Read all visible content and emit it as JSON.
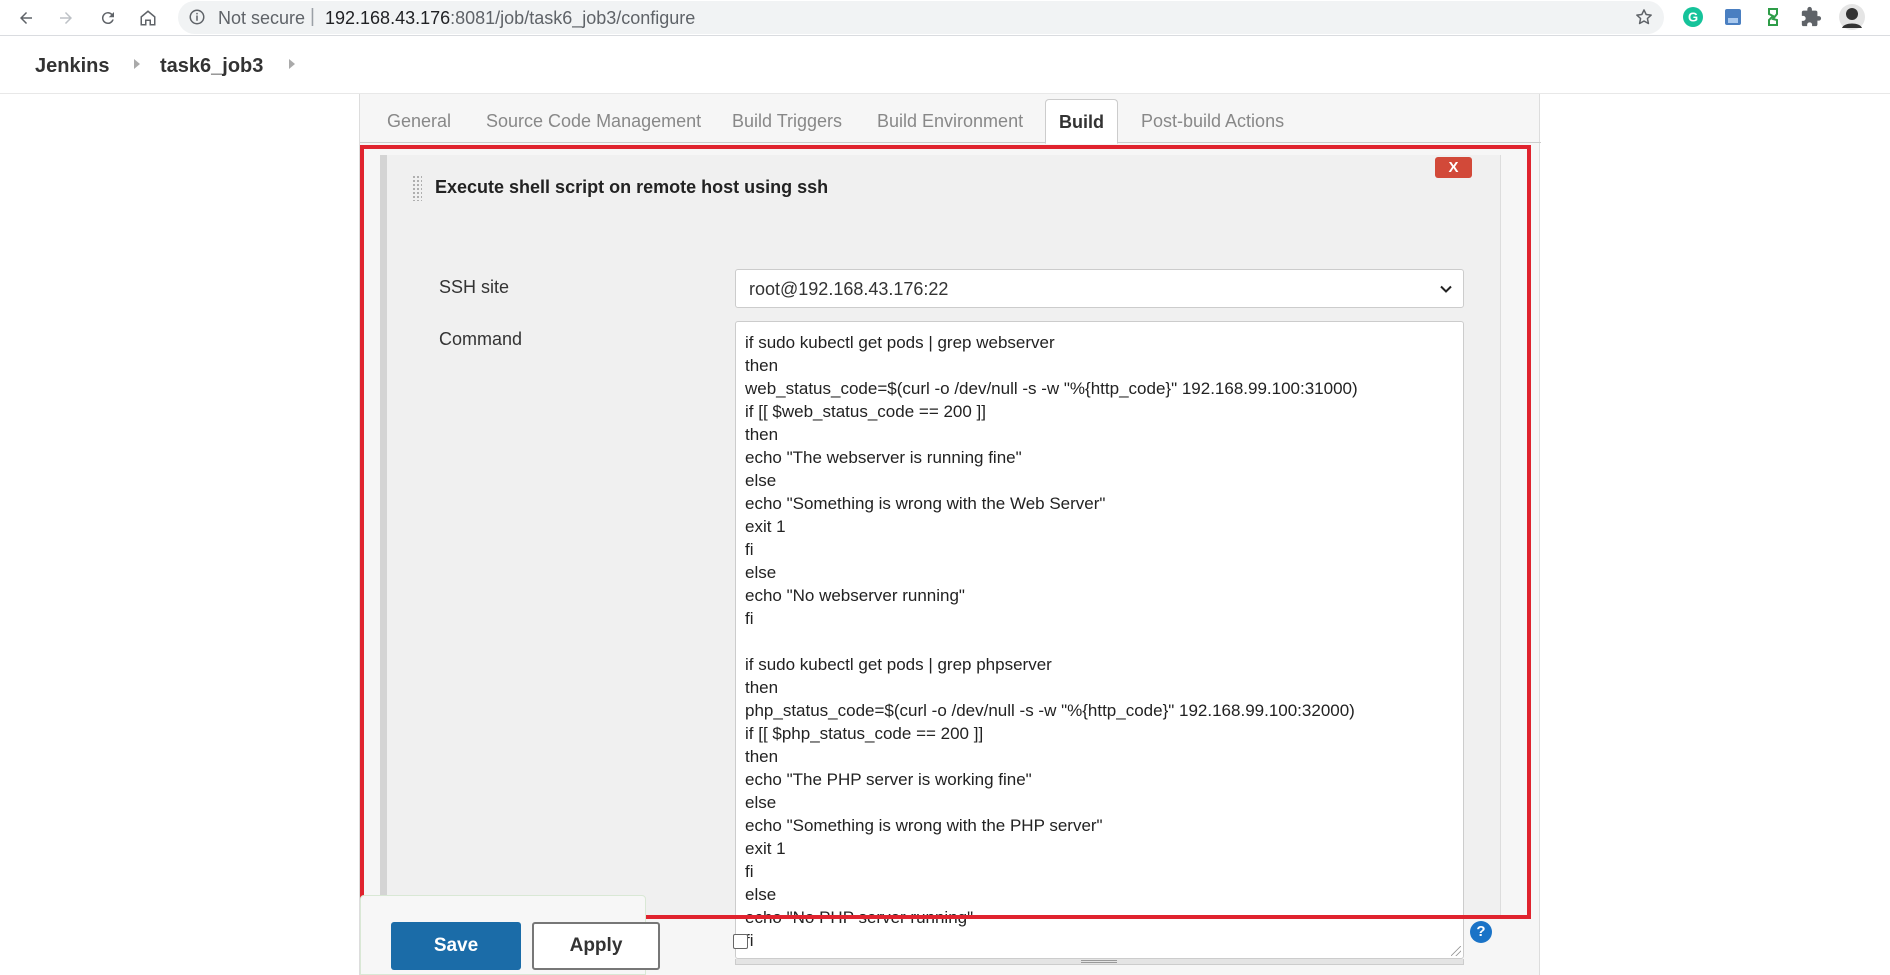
{
  "browser": {
    "security_label": "Not secure",
    "url_separator": "|",
    "url_host": "192.168.43.176",
    "url_path": ":8081/job/task6_job3/configure",
    "icons": [
      "back-arrow-icon",
      "forward-arrow-icon",
      "reload-icon",
      "home-icon",
      "info-icon",
      "star-icon",
      "grammarly-extension-icon",
      "translate-extension-icon",
      "green-extension-icon",
      "puzzle-extensions-icon",
      "profile-avatar"
    ]
  },
  "breadcrumb": {
    "items": [
      "Jenkins",
      "task6_job3"
    ]
  },
  "tabs": [
    {
      "label": "General",
      "active": false
    },
    {
      "label": "Source Code Management",
      "active": false
    },
    {
      "label": "Build Triggers",
      "active": false
    },
    {
      "label": "Build Environment",
      "active": false
    },
    {
      "label": "Build",
      "active": true
    },
    {
      "label": "Post-build Actions",
      "active": false
    }
  ],
  "build_step": {
    "title": "Execute shell script on remote host using ssh",
    "delete_label": "X",
    "ssh_site_label": "SSH site",
    "ssh_site_value": "root@192.168.43.176:22",
    "command_label": "Command",
    "command": "if sudo kubectl get pods | grep webserver\nthen\nweb_status_code=$(curl -o /dev/null -s -w \"%{http_code}\" 192.168.99.100:31000)\nif [[ $web_status_code == 200 ]]\nthen\necho \"The webserver is running fine\"\nelse\necho \"Something is wrong with the Web Server\"\nexit 1\nfi\nelse\necho \"No webserver running\"\nfi\n\nif sudo kubectl get pods | grep phpserver\nthen\nphp_status_code=$(curl -o /dev/null -s -w \"%{http_code}\" 192.168.99.100:32000)\nif [[ $php_status_code == 200 ]]\nthen\necho \"The PHP server is working fine\"\nelse\necho \"Something is wrong with the PHP server\"\nexit 1\nfi\nelse\necho \"No PHP server running\"\nfi"
  },
  "footer": {
    "save_label": "Save",
    "apply_label": "Apply",
    "help_label": "?",
    "checkbox_checked": false
  },
  "colors": {
    "highlight": "#e0232e",
    "save_button": "#1b6ca8",
    "delete_button": "#d24939"
  }
}
